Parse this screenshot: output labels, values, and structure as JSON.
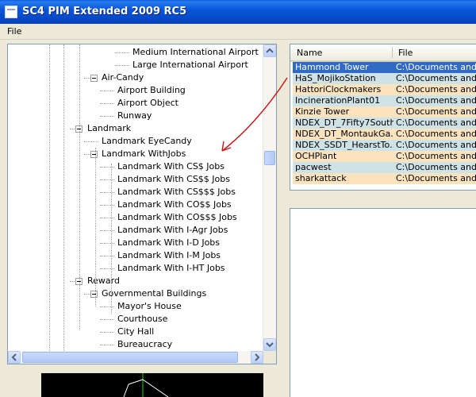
{
  "window": {
    "title": "SC4 PIM Extended 2009 RC5"
  },
  "menu": {
    "file_label": "File"
  },
  "tree": {
    "nodes": [
      {
        "label": "Medium International Airport",
        "level": 4,
        "expander": false
      },
      {
        "label": "Large International Airport",
        "level": 4,
        "expander": false
      },
      {
        "label": "Air-Candy",
        "level": 2,
        "expander": true
      },
      {
        "label": "Airport Building",
        "level": 3,
        "expander": false
      },
      {
        "label": "Airport Object",
        "level": 3,
        "expander": false
      },
      {
        "label": "Runway",
        "level": 3,
        "expander": false
      },
      {
        "label": "Landmark",
        "level": 1,
        "expander": true
      },
      {
        "label": "Landmark EyeCandy",
        "level": 2,
        "expander": false
      },
      {
        "label": "Landmark WithJobs",
        "level": 2,
        "expander": true
      },
      {
        "label": "Landmark With CS$ Jobs",
        "level": 3,
        "expander": false
      },
      {
        "label": "Landmark With CS$$ Jobs",
        "level": 3,
        "expander": false
      },
      {
        "label": "Landmark With CS$$$ Jobs",
        "level": 3,
        "expander": false
      },
      {
        "label": "Landmark With CO$$ Jobs",
        "level": 3,
        "expander": false
      },
      {
        "label": "Landmark With CO$$$ Jobs",
        "level": 3,
        "expander": false
      },
      {
        "label": "Landmark With I-Agr Jobs",
        "level": 3,
        "expander": false
      },
      {
        "label": "Landmark With I-D Jobs",
        "level": 3,
        "expander": false
      },
      {
        "label": "Landmark With I-M Jobs",
        "level": 3,
        "expander": false
      },
      {
        "label": "Landmark With I-HT Jobs",
        "level": 3,
        "expander": false
      },
      {
        "label": "Reward",
        "level": 1,
        "expander": true
      },
      {
        "label": "Governmental Buildings",
        "level": 2,
        "expander": true
      },
      {
        "label": "Mayor's House",
        "level": 3,
        "expander": false
      },
      {
        "label": "Courthouse",
        "level": 3,
        "expander": false
      },
      {
        "label": "City Hall",
        "level": 3,
        "expander": false
      },
      {
        "label": "Bureaucracy",
        "level": 3,
        "expander": false
      }
    ]
  },
  "list": {
    "columns": [
      "Name",
      "File"
    ],
    "rows": [
      {
        "name": "Hammond Tower",
        "file": "C:\\Documents and Se",
        "style": "sel"
      },
      {
        "name": "HaS_MojikoStation",
        "file": "C:\\Documents and Se",
        "style": "blue"
      },
      {
        "name": "HattoriClockmakers",
        "file": "C:\\Documents and Se",
        "style": "tan"
      },
      {
        "name": "IncinerationPlant01",
        "file": "C:\\Documents and Se",
        "style": "blue"
      },
      {
        "name": "Kinzie Tower",
        "file": "C:\\Documents and Se",
        "style": "tan"
      },
      {
        "name": "NDEX_DT_7Fifty7South",
        "file": "C:\\Documents and Se",
        "style": "blue"
      },
      {
        "name": "NDEX_DT_MontaukGa...",
        "file": "C:\\Documents and Se",
        "style": "tan"
      },
      {
        "name": "NDEX_SSDT_HearstTo...",
        "file": "C:\\Documents and Se",
        "style": "blue"
      },
      {
        "name": "OCHPlant",
        "file": "C:\\Documents and Se",
        "style": "tan"
      },
      {
        "name": "pacwest",
        "file": "C:\\Documents and Se",
        "style": "blue"
      },
      {
        "name": "sharkattack",
        "file": "C:\\Documents and Se",
        "style": "tan"
      }
    ]
  },
  "colors": {
    "selection": "#316ac5",
    "row_blue": "#cfe2e6",
    "row_tan": "#fbe3bf",
    "annotation": "#cc1111"
  },
  "icons": [
    "app-icon",
    "scroll-up-icon",
    "scroll-down-icon",
    "scroll-left-icon",
    "scroll-right-icon",
    "annotation-arrow"
  ]
}
